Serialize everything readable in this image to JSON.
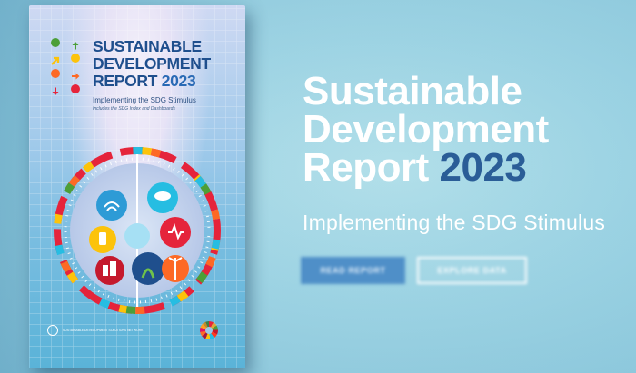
{
  "hero": {
    "title_line1": "Sustainable",
    "title_line2": "Development",
    "title_line3": "Report",
    "year": "2023",
    "subtitle": "Implementing the SDG Stimulus"
  },
  "buttons": {
    "read": "READ REPORT",
    "explore": "EXPLORE DATA"
  },
  "cover": {
    "title_line1": "SUSTAINABLE",
    "title_line2": "DEVELOPMENT",
    "title_line3": "REPORT",
    "year": "2023",
    "subtitle": "Implementing the SDG Stimulus",
    "note": "Includes the SDG Index and Dashboards",
    "publisher": "SUSTAINABLE DEVELOPMENT SOLUTIONS NETWORK"
  },
  "colors": {
    "accent_year": "#2a5d97",
    "primary_button": "#4f8fc8",
    "sdg_red": "#e5243b",
    "sdg_green": "#4c9f38",
    "sdg_yellow": "#fcc30b",
    "sdg_orange": "#fd6925",
    "sdg_blue": "#26bde2"
  },
  "icons": {
    "logo": [
      "circle",
      "arrow-up",
      "arrow-diagonal",
      "circle",
      "arrow-right",
      "circle",
      "arrow-down",
      "circle"
    ],
    "gauge_segments": [
      "wifi-icon",
      "cloud-person-icon",
      "heart-pulse-icon",
      "phone-icon",
      "brain-icon",
      "buildings-icon",
      "plant-icon",
      "wind-turbine-icon"
    ]
  }
}
